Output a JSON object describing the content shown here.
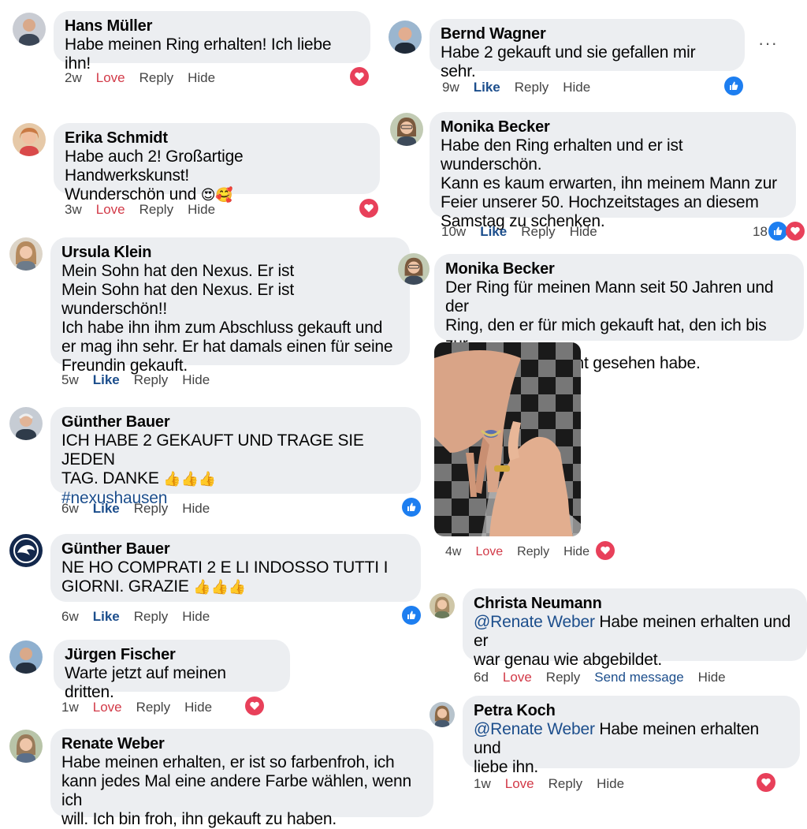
{
  "comments": {
    "hans": {
      "name": "Hans Müller",
      "text": "Habe meinen Ring erhalten! Ich liebe ihn!",
      "time": "2w",
      "react": "Love",
      "reply": "Reply",
      "hide": "Hide"
    },
    "erika": {
      "name": "Erika Schmidt",
      "line1": "Habe auch 2! Großartige Handwerkskunst!",
      "line2": "Wunderschön und",
      "emoji": "😍🥰",
      "time": "3w",
      "react": "Love",
      "reply": "Reply",
      "hide": "Hide"
    },
    "ursula": {
      "name": "Ursula Klein",
      "lines": [
        "Mein Sohn hat den Nexus. Er ist",
        "Mein Sohn hat den Nexus. Er ist wunderschön!!",
        "Ich habe ihn ihm zum Abschluss gekauft und",
        "er mag ihn sehr. Er hat damals einen für seine",
        "Freundin gekauft."
      ],
      "time": "5w",
      "react": "Like",
      "reply": "Reply",
      "hide": "Hide"
    },
    "guenther1": {
      "name": "Günther Bauer",
      "lines": [
        "ICH HABE 2 GEKAUFT UND TRAGE SIE JEDEN",
        "TAG. DANKE"
      ],
      "emoji": "👍👍👍",
      "hashtag": "#nexushausen",
      "time": "6w",
      "react": "Like",
      "reply": "Reply",
      "hide": "Hide"
    },
    "guenther2": {
      "name": "Günther Bauer",
      "lines": [
        "NE HO COMPRATI 2 E LI INDOSSO TUTTI I",
        "GIORNI. GRAZIE"
      ],
      "emoji": "👍👍👍",
      "time": "6w",
      "react": "Like",
      "reply": "Reply",
      "hide": "Hide"
    },
    "juergen": {
      "name": "Jürgen Fischer",
      "text": "Warte jetzt auf meinen dritten.",
      "time": "1w",
      "react": "Love",
      "reply": "Reply",
      "hide": "Hide"
    },
    "renate": {
      "name": "Renate Weber",
      "lines": [
        "Habe meinen erhalten, er ist so farbenfroh, ich",
        "kann jedes Mal eine andere Farbe wählen, wenn ich",
        "will. Ich bin froh, ihn gekauft zu haben."
      ]
    },
    "bernd": {
      "name": "Bernd Wagner",
      "text": "Habe 2 gekauft und sie gefallen mir sehr.",
      "time": "9w",
      "react": "Like",
      "reply": "Reply",
      "hide": "Hide",
      "more": "···"
    },
    "monika1": {
      "name": "Monika Becker",
      "lines": [
        "Habe den Ring erhalten und er ist wunderschön.",
        "Kann es kaum erwarten, ihn meinem Mann zur",
        "Feier unserer 50. Hochzeitstages an diesem",
        "Samstag zu schenken."
      ],
      "time": "10w",
      "react": "Like",
      "reply": "Reply",
      "hide": "Hide",
      "count": "18"
    },
    "monika2": {
      "name": "Monika Becker",
      "lines": [
        "Der Ring für meinen Mann seit 50 Jahren und der",
        "Ring, den er für mich gekauft hat, den ich bis zur",
        "Jubiläumsfeier nicht gesehen habe."
      ],
      "time": "4w",
      "react": "Love",
      "reply": "Reply",
      "hide": "Hide"
    },
    "christa": {
      "name": "Christa Neumann",
      "mention": "@Renate Weber",
      "rest1": " Habe meinen erhalten und er",
      "line2": "war genau wie abgebildet.",
      "time": "6d",
      "react": "Love",
      "reply": "Reply",
      "send": "Send message",
      "hide": "Hide"
    },
    "petra": {
      "name": "Petra Koch",
      "mention": "@Renate Weber",
      "rest1": " Habe meinen erhalten und",
      "line2": "liebe ihn.",
      "time": "1w",
      "react": "Love",
      "reply": "Reply",
      "hide": "Hide"
    }
  },
  "colors": {
    "bubble": "#eceef1",
    "love": "#d23a48",
    "like": "#1c4e8c",
    "heart_badge": "#e8405a",
    "like_badge": "#1d7ef0"
  },
  "icons": {
    "reaction_love": "heart-icon",
    "reaction_like": "thumbs-up-icon",
    "more": "more-options-icon"
  }
}
